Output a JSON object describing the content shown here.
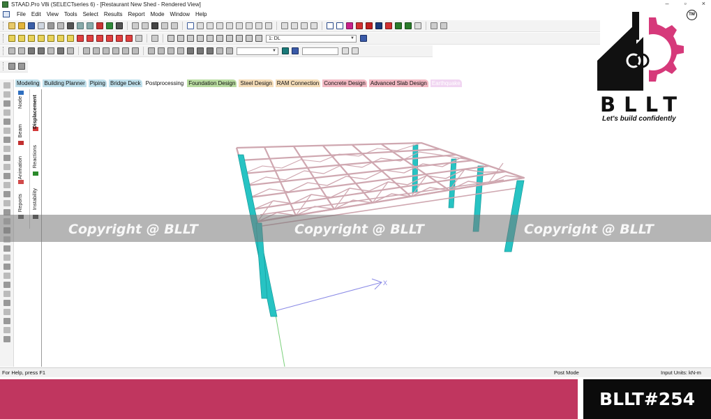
{
  "window": {
    "title": "STAAD.Pro V8i (SELECTseries 6) - [Restaurant New Shed - Rendered View]",
    "controls": [
      "–",
      "▫",
      "×"
    ]
  },
  "menu": [
    "File",
    "Edit",
    "View",
    "Tools",
    "Select",
    "Results",
    "Report",
    "Mode",
    "Window",
    "Help"
  ],
  "toolbar": {
    "load_case": "1: DL"
  },
  "workflow_tabs": [
    {
      "label": "Modeling",
      "color": "#bfe0ec"
    },
    {
      "label": "Building Planner",
      "color": "#bfe0ec"
    },
    {
      "label": "Piping",
      "color": "#bfe0ec"
    },
    {
      "label": "Bridge Deck",
      "color": "#bfe0ec"
    },
    {
      "label": "Postprocessing",
      "color": "#ffffff"
    },
    {
      "label": "Foundation Design",
      "color": "#b9dca1"
    },
    {
      "label": "Steel Design",
      "color": "#f4dcb8"
    },
    {
      "label": "RAM Connection",
      "color": "#f4dcb8"
    },
    {
      "label": "Concrete Design",
      "color": "#f2b9c3"
    },
    {
      "label": "Advanced Slab Design",
      "color": "#f2b9c3"
    },
    {
      "label": "Earthquake",
      "color": "#f1d6f2"
    }
  ],
  "side_tabs": {
    "col1": [
      "Node",
      "Beam",
      "Animation",
      "Reports"
    ],
    "col2": [
      "Displacement",
      "Reactions",
      "Instability"
    ]
  },
  "viewport": {
    "axis_label": "X",
    "column_color": "#27c3c3",
    "truss_color": "#cfa7b0"
  },
  "watermark": "Copyright @ BLLT",
  "logo": {
    "word": "BLLT",
    "tagline": "Let's build confidently",
    "tm": "TM",
    "accent": "#d6397a"
  },
  "status": {
    "help": "For Help, press F1",
    "mode": "Post Mode",
    "units": "Input Units:  kN-m"
  },
  "footer": {
    "code": "BLLT#254",
    "bar_color": "#c0365f"
  }
}
